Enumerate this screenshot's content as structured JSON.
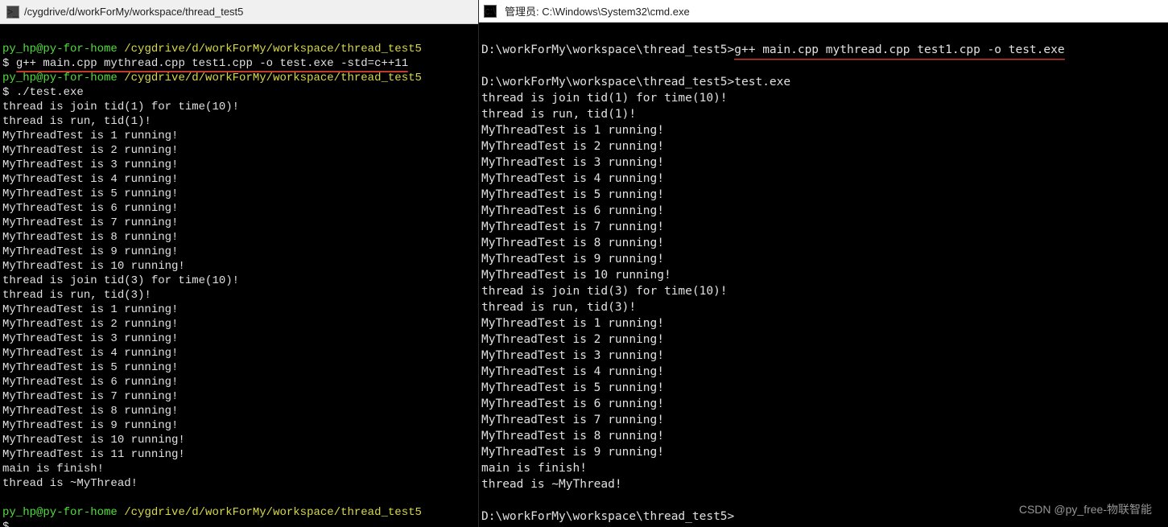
{
  "left": {
    "title": "/cygdrive/d/workForMy/workspace/thread_test5",
    "ps_user": "py_hp@py-for-home",
    "ps_cwd": "/cygdrive/d/workForMy/workspace/thread_test5",
    "cmd1": "g++ main.cpp mythread.cpp test1.cpp -o test.exe -std=c++11",
    "cmd2": "./test.exe",
    "out": [
      "thread is join tid(1) for time(10)!",
      "thread is run, tid(1)!",
      "MyThreadTest is 1 running!",
      "MyThreadTest is 2 running!",
      "MyThreadTest is 3 running!",
      "MyThreadTest is 4 running!",
      "MyThreadTest is 5 running!",
      "MyThreadTest is 6 running!",
      "MyThreadTest is 7 running!",
      "MyThreadTest is 8 running!",
      "MyThreadTest is 9 running!",
      "MyThreadTest is 10 running!",
      "thread is join tid(3) for time(10)!",
      "thread is run, tid(3)!",
      "MyThreadTest is 1 running!",
      "MyThreadTest is 2 running!",
      "MyThreadTest is 3 running!",
      "MyThreadTest is 4 running!",
      "MyThreadTest is 5 running!",
      "MyThreadTest is 6 running!",
      "MyThreadTest is 7 running!",
      "MyThreadTest is 8 running!",
      "MyThreadTest is 9 running!",
      "MyThreadTest is 10 running!",
      "MyThreadTest is 11 running!",
      "main is finish!",
      "thread is ~MyThread!"
    ],
    "ps_fragment": ""
  },
  "right": {
    "title": "管理员: C:\\Windows\\System32\\cmd.exe",
    "prompt": "D:\\workForMy\\workspace\\thread_test5>",
    "cmd1": "g++ main.cpp mythread.cpp test1.cpp -o test.exe",
    "cmd2": "test.exe",
    "out": [
      "thread is join tid(1) for time(10)!",
      "thread is run, tid(1)!",
      "MyThreadTest is 1 running!",
      "MyThreadTest is 2 running!",
      "MyThreadTest is 3 running!",
      "MyThreadTest is 4 running!",
      "MyThreadTest is 5 running!",
      "MyThreadTest is 6 running!",
      "MyThreadTest is 7 running!",
      "MyThreadTest is 8 running!",
      "MyThreadTest is 9 running!",
      "MyThreadTest is 10 running!",
      "thread is join tid(3) for time(10)!",
      "thread is run, tid(3)!",
      "MyThreadTest is 1 running!",
      "MyThreadTest is 2 running!",
      "MyThreadTest is 3 running!",
      "MyThreadTest is 4 running!",
      "MyThreadTest is 5 running!",
      "MyThreadTest is 6 running!",
      "MyThreadTest is 7 running!",
      "MyThreadTest is 8 running!",
      "MyThreadTest is 9 running!",
      "main is finish!",
      "thread is ~MyThread!"
    ]
  },
  "watermark": "CSDN @py_free-物联智能"
}
